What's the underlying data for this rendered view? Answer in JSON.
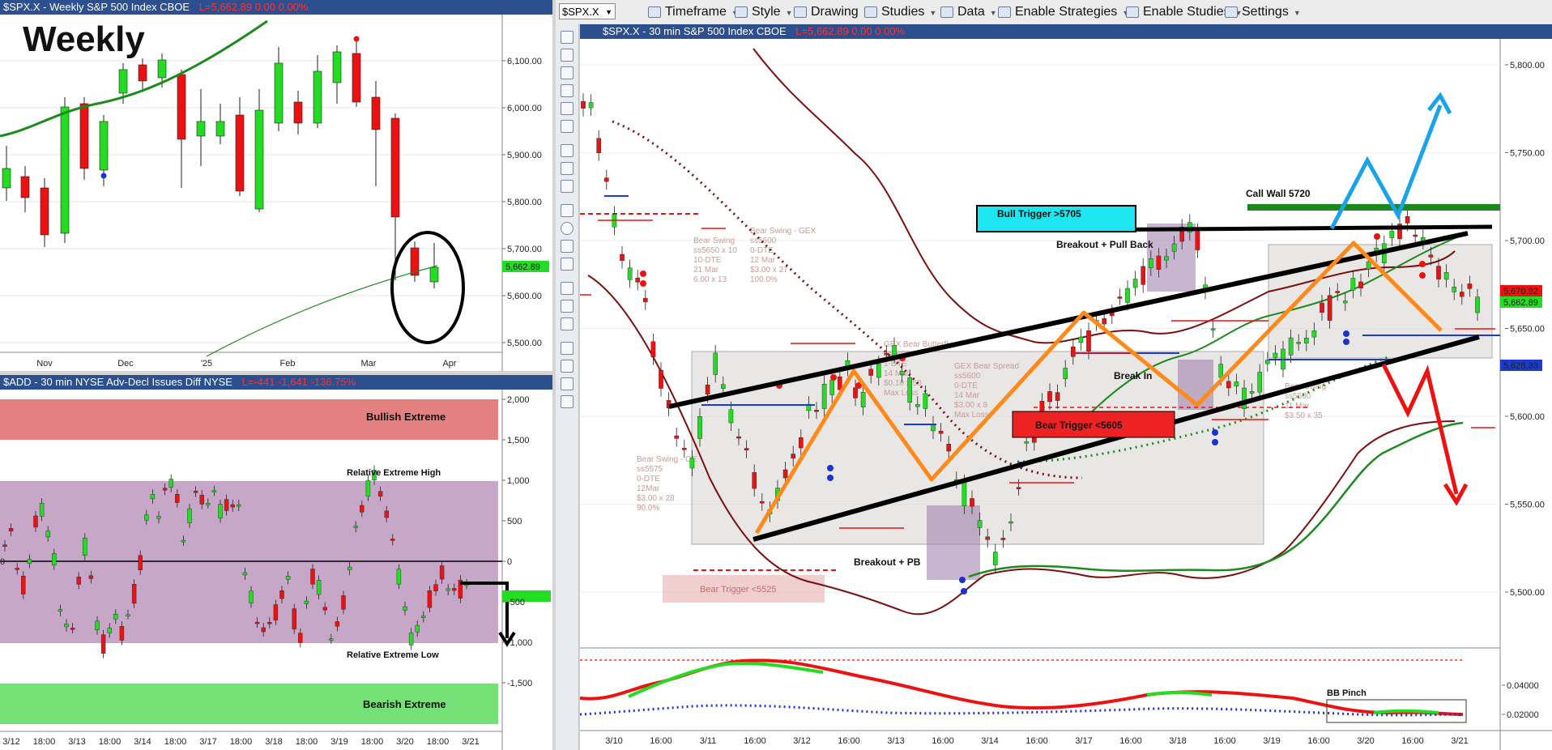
{
  "weekly": {
    "header": "$SPX.X - Weekly  S&P 500 Index  CBOE",
    "quote": "L=5,662.89  0.00  0.00%",
    "big_title": "Weekly",
    "price_labels": [
      "6,100.00",
      "6,000.00",
      "5,900.00",
      "5,800.00",
      "5,700.00",
      "5,600.00",
      "5,500.00"
    ],
    "last_price": "5,662.89",
    "date_labels": [
      "Nov",
      "Dec",
      "'25",
      "Feb",
      "Mar",
      "Apr"
    ]
  },
  "breadth": {
    "header": "$ADD - 30 min  NYSE Adv-Decl Issues Diff  NYSE",
    "quote": "L=-441  -1,641  -136.75%",
    "value_labels": [
      "2,000",
      "1,500",
      "1,000",
      "500",
      "0",
      "-500",
      "-1,000",
      "-1,500"
    ],
    "zones": {
      "bullish_extreme": "Bullish Extreme",
      "relative_high": "Relative Extreme High",
      "relative_low": "Relative Extreme Low",
      "bearish_extreme": "Bearish Extreme"
    },
    "zero_tag": "0",
    "date_labels": [
      "3/12",
      "18:00",
      "3/13",
      "18:00",
      "3/14",
      "18:00",
      "3/17",
      "18:00",
      "3/18",
      "18:00",
      "3/19",
      "18:00",
      "3/20",
      "18:00",
      "3/21"
    ]
  },
  "toolbar": {
    "symbol": "$SPX.X",
    "timeframe": "Timeframe",
    "style": "Style",
    "drawing": "Drawing",
    "studies": "Studies",
    "data": "Data",
    "enable_strategies": "Enable Strategies",
    "enable_studies": "Enable Studies",
    "settings": "Settings"
  },
  "main": {
    "header": "$SPX.X - 30 min  S&P 500 Index  CBOE",
    "quote": "L=5,662.89  0.00  0.00%",
    "price_labels": [
      "5,800.00",
      "5,750.00",
      "5,700.00",
      "5,650.00",
      "5,600.00",
      "5,550.00",
      "5,500.00"
    ],
    "tags": {
      "red": "5,670.92",
      "green": "5,662.89",
      "blue": "5,628.33"
    },
    "annotations": {
      "bull_trigger": "Bull Trigger >5705",
      "bear_trigger": "Bear Trigger <5605",
      "call_wall": "Call Wall 5720",
      "breakout_pullback": "Breakout + Pull Back",
      "break_in": "Break In",
      "breakout_pb": "Breakout + PB",
      "bb_pinch": "BB Pinch"
    },
    "indicator_labels": [
      "0.04000",
      "0.02000"
    ],
    "date_labels": [
      "3/10",
      "16:00",
      "3/11",
      "16:00",
      "3/12",
      "16:00",
      "3/13",
      "16:00",
      "3/14",
      "16:00",
      "3/17",
      "16:00",
      "3/18",
      "16:00",
      "3/19",
      "16:00",
      "3/20",
      "16:00",
      "3/21"
    ]
  },
  "colors": {
    "bull_candle": "#22dd22",
    "bear_candle": "#ee1111",
    "ma_green": "#1d8a1d",
    "band_maroon": "#7a1010",
    "channel": "#000000",
    "zigzag": "#ff8a1a",
    "arrow_blue": "#1aa3e8",
    "arrow_red": "#ee1111",
    "bull_trigger_bg": "#1ee6f0",
    "bear_trigger_bg": "#ee2222",
    "zone_red": "#e06a6a",
    "zone_purple": "#b48ab4",
    "zone_green": "#66dd66"
  }
}
